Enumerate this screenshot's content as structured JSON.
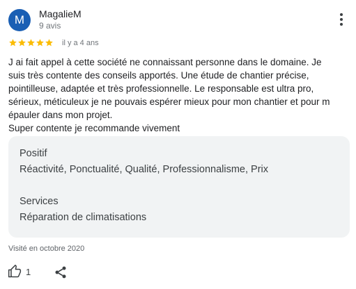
{
  "reviewer": {
    "initial": "M",
    "name": "MagalieM",
    "review_count": "9 avis",
    "avatar_color": "#1a5fb4"
  },
  "review": {
    "rating": 5,
    "max_rating": 5,
    "star_color": "#fbbc04",
    "date": "il y a 4 ans",
    "text_lines": [
      "J ai fait appel à cette société ne connaissant personne dans le domaine. Je",
      "suis très contente des conseils apportés. Une étude de chantier précise,",
      "pointilleuse, adaptée et très professionnelle. Le responsable est ultra pro,",
      "sérieux, méticuleux je ne pouvais espérer mieux pour mon chantier et pour m",
      "épauler dans mon projet.",
      "Super contente je recommande vivement"
    ]
  },
  "attributes": {
    "positive_label": "Positif",
    "positive_value": "Réactivité, Ponctualité, Qualité, Professionnalisme, Prix",
    "services_label": "Services",
    "services_value": "Réparation de climatisations"
  },
  "visit": {
    "text": "Visité en octobre 2020"
  },
  "actions": {
    "like_count": "1",
    "like_icon": "thumb-up-icon",
    "share_icon": "share-icon",
    "more_icon": "more-vert-icon"
  }
}
